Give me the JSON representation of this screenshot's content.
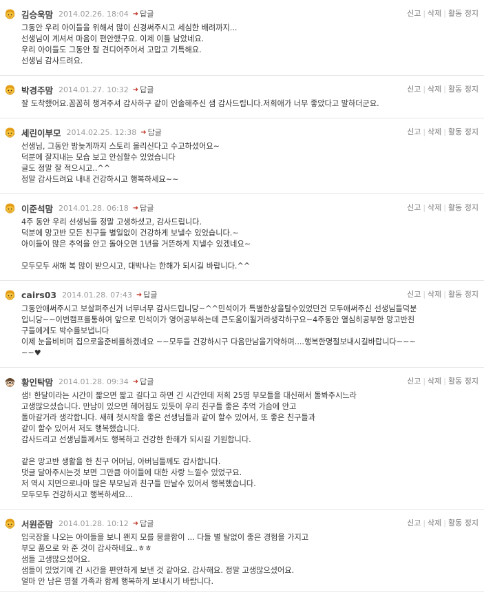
{
  "labels": {
    "reply": "답글",
    "report": "신고",
    "delete": "삭제",
    "suspend": "활동 정지"
  },
  "colors": {
    "avatar_face": "#f6c23a",
    "reply_arrow": "#c0392b",
    "border": "#e5e5e5"
  },
  "comments": [
    {
      "author": "김승욱맘",
      "date": "2014.02.26. 18:04",
      "avatar": "yellow-face-icon",
      "lines": [
        "그동안 우리 아이들을 위해서 많이 신경써주시고 세심한 배려까지...",
        "선생님이 계셔서 마음이 편안했구요. 이제 이틀 남았네요.",
        "우리 아이들도 그동안 잘 견디어주어서 고맙고 기특해요.",
        "선생님 감사드려요."
      ]
    },
    {
      "author": "박경주맘",
      "date": "2014.01.27. 10:32",
      "avatar": "yellow-face-icon",
      "lines": [
        "잘 도착했어요.꼼꼼히 챙겨주셔 감사하구 같이 인솔해주신 샘 감사드립니다.저희애가 너무 좋았다고 말하더군요."
      ]
    },
    {
      "author": "세린이부모",
      "date": "2014.02.25. 12:38",
      "avatar": "yellow-face-icon",
      "lines": [
        "선생님, 그동안 밤늦게까지 스토리 올리신다고 수고하셨어요~",
        "덕분에 잘지내는 모습 보고 안심할수 있었습니다",
        "글도 정말 잘 적으시고..^^",
        "정말 감사드려요 내내 건강하시고 행복하세요~~"
      ]
    },
    {
      "author": "이준석맘",
      "date": "2014.01.28. 06:18",
      "avatar": "yellow-face-icon",
      "lines": [
        "4주 동안 우리 선생님들 정말 고생하셨고, 감사드립니다.",
        "덕분에 망고반 모든 친구들 별일없이 건강하게 보낼수 있었습니다.~",
        "아이들이 많은 추억을 안고 돌아오면 1년을 거뜬하게 지낼수 있겠네요~",
        "",
        "모두모두 새해 복 많이 받으시고, 대박나는 한해가 되시길 바랍니다.^^"
      ]
    },
    {
      "author": "cairs03",
      "date": "2014.01.28. 07:43",
      "avatar": "yellow-face-icon",
      "lines": [
        "그동안애써주시고 보살펴주신거 너무너무 감사드립니당~^^민석이가 특별한상을탈수있었던건 모두애써주신 선생님들덕분",
        "입니당~~이번캠프를통하여 앞으로 민석이가 영어공부하는데 큰도움이될거라생각하구요~4주동안 열심히공부한 망고반친",
        "구들에게도 박수를보냅니다",
        "이제 눈을비비며 집으로올준비를하겠네요 ~~모두들 건강하시구 다음만남을기약하며....행복한명절보내시길바랍니다~~~",
        "~~♥"
      ]
    },
    {
      "author": "황인탁맘",
      "date": "2014.01.28. 09:34",
      "avatar": "glasses-face-icon",
      "lines": [
        "샘! 한달이라는 시간이 짧으면 짧고 길다고 하면 긴 시간인데 저희 25명 부모들을 대신해서 돌봐주시느라",
        "고생많으셨습니다. 만남이 있으면 헤어짐도 있듯이 우리 친구들 좋은 추억 가슴에 안고",
        "돌아갈거라 생각합니다. 새해 첫시작을 좋은 선생님들과 같이 할수 있어서, 또 좋은 친구들과",
        "같이 할수 있어서 저도 행복했습니다.",
        "감사드리고 선생님들께서도 행복하고 건강한 한해가 되시길 기원합니다.",
        "",
        "같은 망고반 생활을 한 친구 어머님, 아버님들께도 감사합니다.",
        "댓글 달아주시는것 보면 그만큼 아이들에 대한 사랑 느낄수 있었구요.",
        "저 역시 지면으로나마 많은 부모님과 친구들 만날수 있어서 행복했습니다.",
        "모두모두 건강하시고 행복하세요..."
      ]
    },
    {
      "author": "서원준맘",
      "date": "2014.01.28. 10:12",
      "avatar": "yellow-face-icon",
      "lines": [
        "입국장을 나오는 아이들을 보니 왠지 모를 뭉클함이 ... 다들 별 탈없이 좋은 경험을 가지고",
        "부모 품으로 와 준 것이 감사하네요..ㅎㅎ",
        "샘들 고생많으셨어요.",
        "샘들이 있었기에 긴 시간을 편안하게 보낸 것 같아요. 감사해요. 정말 고생많으셨어요.",
        "얼마 안 남은 명절 가족과 함께 행복하게 보내시기 바랍니다."
      ]
    }
  ]
}
